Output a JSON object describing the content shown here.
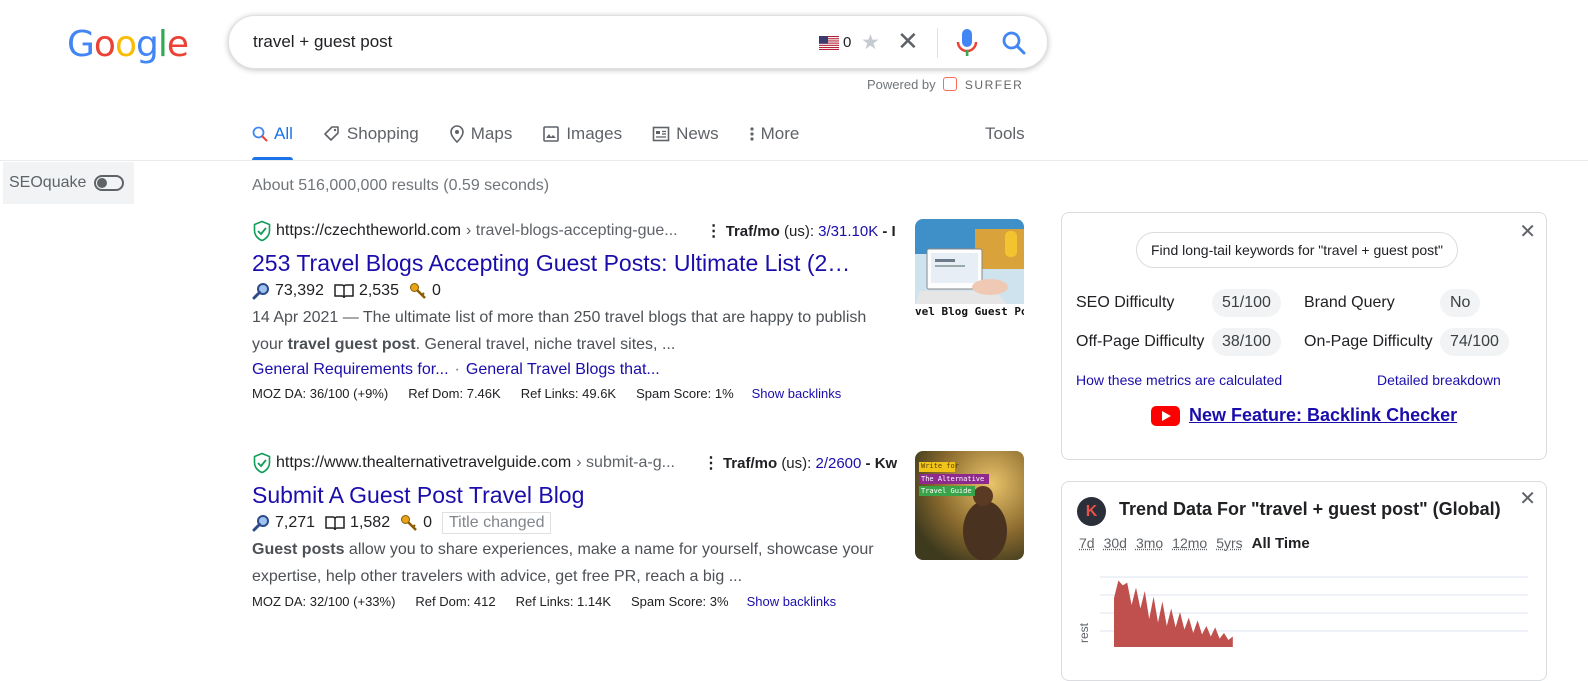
{
  "logo": {
    "letters": [
      "G",
      "o",
      "o",
      "g",
      "l",
      "e"
    ]
  },
  "search": {
    "query": "travel + guest post",
    "flag_count": "0",
    "powered_by_label": "Powered by",
    "powered_by_brand": "SURFER"
  },
  "tabs": [
    {
      "label": "All",
      "icon": "search-icon",
      "active": true
    },
    {
      "label": "Shopping",
      "icon": "tag-icon"
    },
    {
      "label": "Maps",
      "icon": "map-pin-icon"
    },
    {
      "label": "Images",
      "icon": "image-icon"
    },
    {
      "label": "News",
      "icon": "news-icon"
    },
    {
      "label": "More",
      "icon": "more-vert-icon"
    }
  ],
  "tools_label": "Tools",
  "seoquake": {
    "label": "SEOquake"
  },
  "result_stats": "About 516,000,000 results (0.59 seconds)",
  "results": [
    {
      "url": "https://czechtheworld.com",
      "crumb": "› travel-blogs-accepting-gue...",
      "traf_label": "Traf/mo",
      "traf_geo": "(us):",
      "traf_value": "3/31.10K",
      "traf_tail": "- I",
      "title": "253 Travel Blogs Accepting Guest Posts: Ultimate List (2…",
      "m_search": "73,392",
      "m_book": "2,535",
      "m_key": "0",
      "badge": "",
      "snippet_pre": "14 Apr 2021 — The ultimate list of more than 250 travel blogs that are happy to publish your ",
      "snippet_bold": "travel guest post",
      "snippet_post": ". General travel, niche travel sites, ...",
      "sitelink1": "General Requirements for...",
      "sitelink2": "General Travel Blogs that...",
      "moz": "MOZ DA: 36/100 (+9%)",
      "refdom": "Ref Dom: 7.46K",
      "reflinks": "Ref Links: 49.6K",
      "spam": "Spam Score: 1%",
      "backlinks": "Show backlinks",
      "thumb_caption": "vel Blog Guest Pos"
    },
    {
      "url": "https://www.thealternativetravelguide.com",
      "crumb": "› submit-a-g...",
      "traf_label": "Traf/mo",
      "traf_geo": "(us):",
      "traf_value": "2/2600",
      "traf_tail": "- Kw",
      "title": "Submit A Guest Post Travel Blog",
      "m_search": "7,271",
      "m_book": "1,582",
      "m_key": "0",
      "badge": "Title changed",
      "snippet_bold": "Guest posts",
      "snippet_post": " allow you to share experiences, make a name for yourself, showcase your expertise, help other travelers with advice, get free PR, reach a big ...",
      "moz": "MOZ DA: 32/100 (+33%)",
      "refdom": "Ref Dom: 412",
      "reflinks": "Ref Links: 1.14K",
      "spam": "Spam Score: 3%",
      "backlinks": "Show backlinks",
      "thumb_line1": "Write for",
      "thumb_line2": "The Alternative",
      "thumb_line3": "Travel Guide"
    }
  ],
  "panel1": {
    "longtail_button": "Find long-tail keywords for \"travel + guest post\"",
    "seo_difficulty_label": "SEO Difficulty",
    "seo_difficulty_value": "51/100",
    "brand_query_label": "Brand Query",
    "brand_query_value": "No",
    "offpage_label": "Off-Page Difficulty",
    "offpage_value": "38/100",
    "onpage_label": "On-Page Difficulty",
    "onpage_value": "74/100",
    "metrics_link": "How these metrics are calculated",
    "breakdown_link": "Detailed breakdown",
    "new_feature": "New Feature: Backlink Checker"
  },
  "panel2": {
    "logo_letter": "K",
    "title": "Trend Data For \"travel + guest post\" (Global)",
    "ranges": [
      "7d",
      "30d",
      "3mo",
      "12mo",
      "5yrs",
      "All Time"
    ],
    "selected_range": "All Time",
    "axis_label": "rest"
  },
  "chart_data": {
    "type": "area",
    "ylabel": "rest",
    "values": [
      70,
      95,
      88,
      92,
      60,
      85,
      55,
      80,
      40,
      72,
      35,
      65,
      30,
      55,
      28,
      50,
      25,
      42,
      20,
      38,
      18,
      30,
      15,
      28,
      12,
      20,
      10,
      15
    ],
    "color": "#c0504d"
  },
  "colors": {
    "link": "#1a0dab",
    "accent": "#1a73e8",
    "trend": "#c0504d"
  }
}
